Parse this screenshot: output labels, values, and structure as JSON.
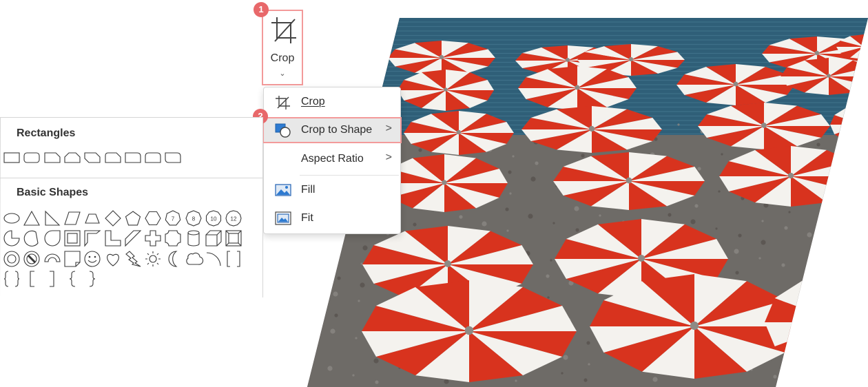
{
  "ribbon": {
    "crop_button_label": "Crop",
    "crop_chevron": "⌄",
    "crop_icon": "crop-icon",
    "step1_badge": "1",
    "step2_badge": "2"
  },
  "menu": {
    "items": [
      {
        "label": "Crop",
        "icon": "crop-icon",
        "has_submenu": false
      },
      {
        "label": "Crop to Shape",
        "icon": "crop-to-shape-icon",
        "has_submenu": true,
        "highlighted": true
      },
      {
        "label": "Aspect Ratio",
        "icon": "",
        "has_submenu": true
      },
      {
        "label": "Fill",
        "icon": "fill-image-icon",
        "has_submenu": false
      },
      {
        "label": "Fit",
        "icon": "fit-image-icon",
        "has_submenu": false
      }
    ],
    "submenu_arrow": ">"
  },
  "gallery": {
    "sections": [
      {
        "title": "Rectangles"
      },
      {
        "title": "Basic Shapes"
      }
    ],
    "rectangles": [
      "rectangle",
      "rounded-rectangle",
      "snip-single-corner-rectangle",
      "snip-same-side-rectangle",
      "snip-diagonal-rectangle",
      "snip-round-rectangle",
      "round-single-corner-rectangle",
      "round-same-side-rectangle",
      "round-diagonal-rectangle"
    ],
    "basic_shapes": [
      "oval",
      "isosceles-triangle",
      "right-triangle",
      "parallelogram",
      "trapezoid",
      "diamond",
      "pentagon",
      "hexagon",
      "heptagon",
      "octagon",
      "decagon",
      "dodecagon",
      "pie",
      "chord",
      "teardrop",
      "frame",
      "half-frame",
      "l-shape",
      "diagonal-stripe",
      "cross",
      "plaque",
      "can",
      "cube",
      "bevel",
      "donut",
      "no-symbol",
      "block-arc",
      "folded-corner",
      "smiley-face",
      "heart",
      "lightning-bolt",
      "sun",
      "moon",
      "cloud",
      "arc",
      "double-bracket",
      "double-brace",
      "left-bracket",
      "right-bracket",
      "left-brace",
      "right-brace"
    ],
    "polygon_numbers": [
      "7",
      "8",
      "10",
      "12"
    ]
  },
  "colors": {
    "highlight_border": "#f39a9a",
    "badge": "#e8686a",
    "umbrella_red": "#d8331e",
    "sea": "#2f5f78"
  }
}
